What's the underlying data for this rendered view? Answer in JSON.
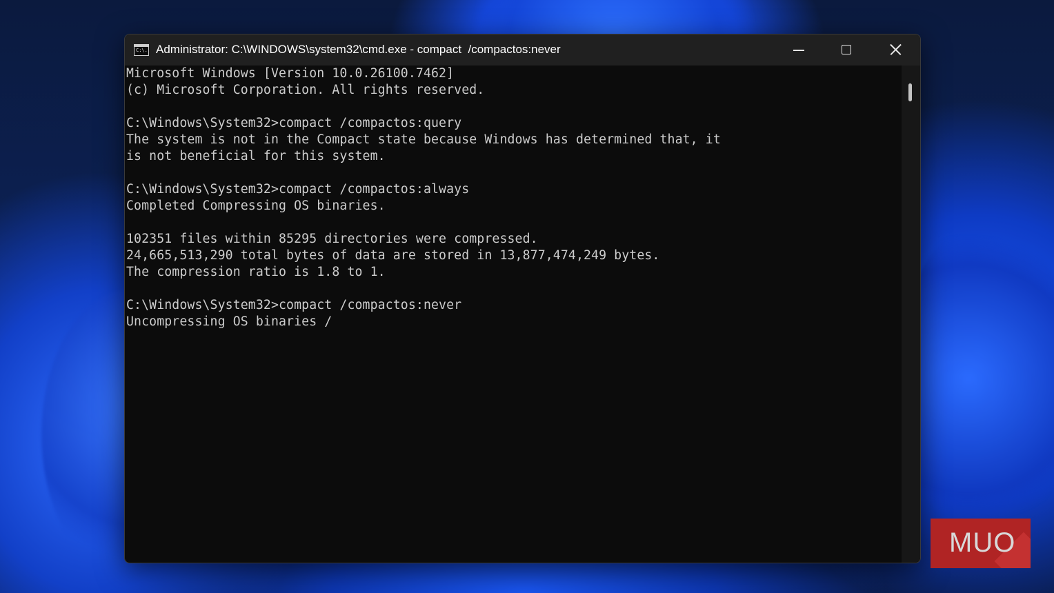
{
  "window": {
    "title": "Administrator: C:\\WINDOWS\\system32\\cmd.exe - compact  /compactos:never",
    "app_icon": "cmd-icon",
    "app_icon_text": "C:\\.",
    "controls": {
      "minimize": "minimize-icon",
      "maximize": "maximize-icon",
      "close": "close-icon"
    }
  },
  "console": {
    "lines": [
      "Microsoft Windows [Version 10.0.26100.7462]",
      "(c) Microsoft Corporation. All rights reserved.",
      "",
      "C:\\Windows\\System32>compact /compactos:query",
      "The system is not in the Compact state because Windows has determined that, it",
      "is not beneficial for this system.",
      "",
      "C:\\Windows\\System32>compact /compactos:always",
      "Completed Compressing OS binaries.",
      "",
      "102351 files within 85295 directories were compressed.",
      "24,665,513,290 total bytes of data are stored in 13,877,474,249 bytes.",
      "The compression ratio is 1.8 to 1.",
      "",
      "C:\\Windows\\System32>compact /compactos:never",
      "Uncompressing OS binaries /"
    ]
  },
  "watermark": {
    "text": "MUO"
  },
  "colors": {
    "console_bg": "#0c0c0c",
    "console_text": "#cccccc",
    "titlebar_bg": "#202020",
    "logo_bg": "#b02424"
  }
}
